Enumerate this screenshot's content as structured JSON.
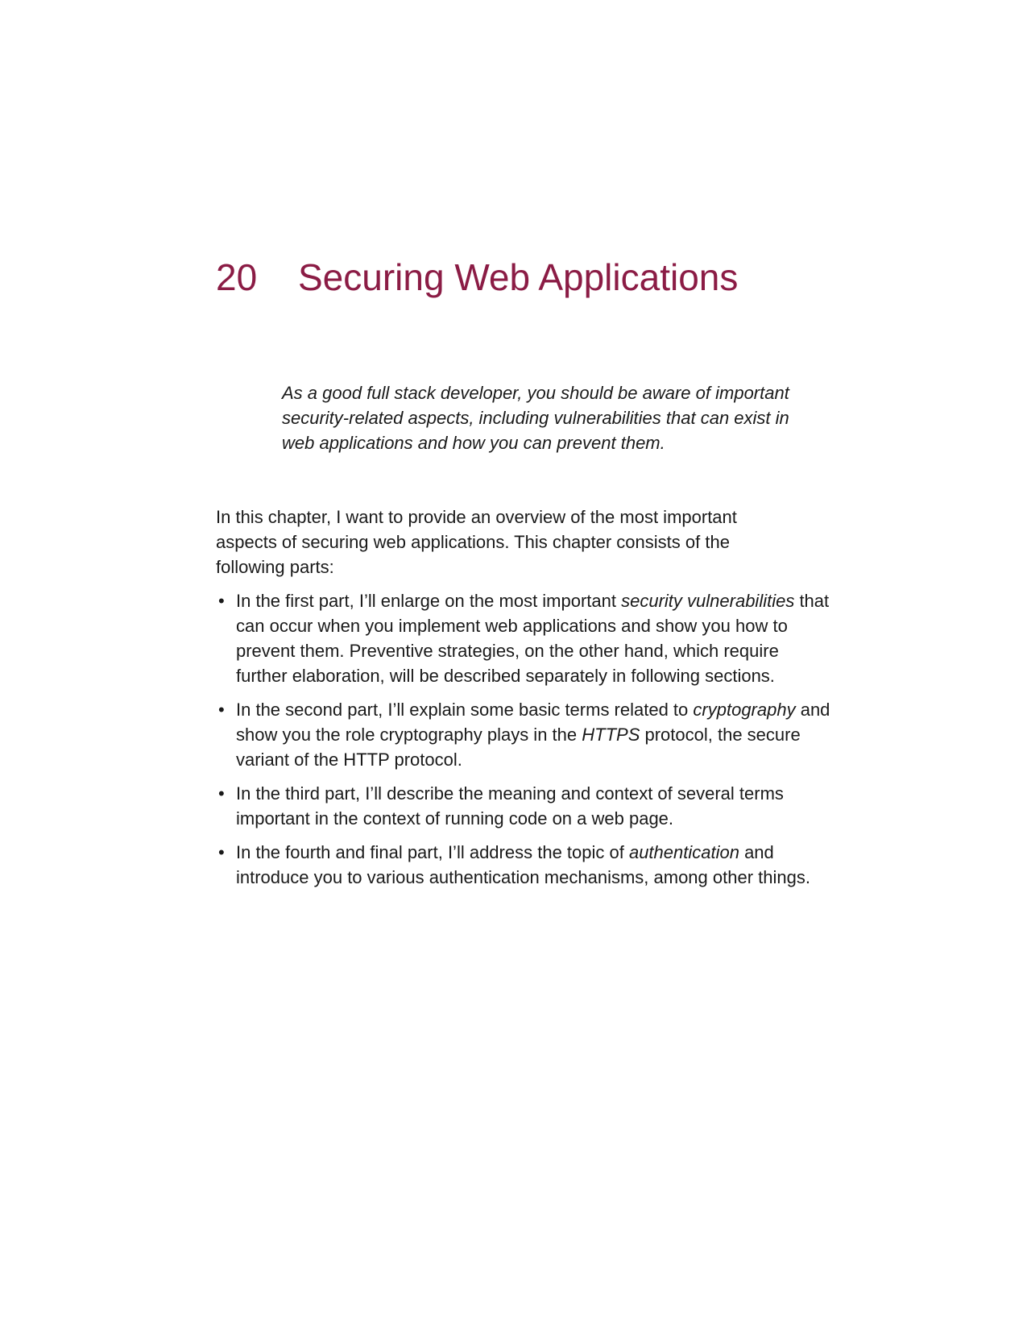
{
  "chapter": {
    "number": "20",
    "title": "Securing Web Applications"
  },
  "epigraph": "As a good full stack developer, you should be aware of important security-related aspects, including vulnerabilities that can exist in web applications and how you can prevent them.",
  "intro": "In this chapter, I want to provide an overview of the most important aspects of securing web applications. This chapter consists of the following parts:",
  "bullet_glyph": "•",
  "bullets": [
    {
      "before": "In the first part, I’ll enlarge on the most important ",
      "emphasis": "security vulnerabilities",
      "after": " that can occur when you implement web applications and show you how to prevent them. Preventive strategies, on the other hand, which require further elaboration, will be described separately in following sections."
    },
    {
      "before": "In the second part, I’ll explain some basic terms related to ",
      "emphasis": "cryptography",
      "middle": " and show you the role cryptography plays in the ",
      "emphasis2": "HTTPS",
      "after": " protocol, the secure variant of the HTTP protocol."
    },
    {
      "text": "In the third part, I’ll describe the meaning and context of several terms important in the context of running code on a web page."
    },
    {
      "before": "In the fourth and final part, I’ll address the topic of ",
      "emphasis": "authentication",
      "after": " and introduce you to various authentication mechanisms, among other things."
    }
  ],
  "colors": {
    "heading": "#8b1c45",
    "text": "#1a1a1a"
  }
}
